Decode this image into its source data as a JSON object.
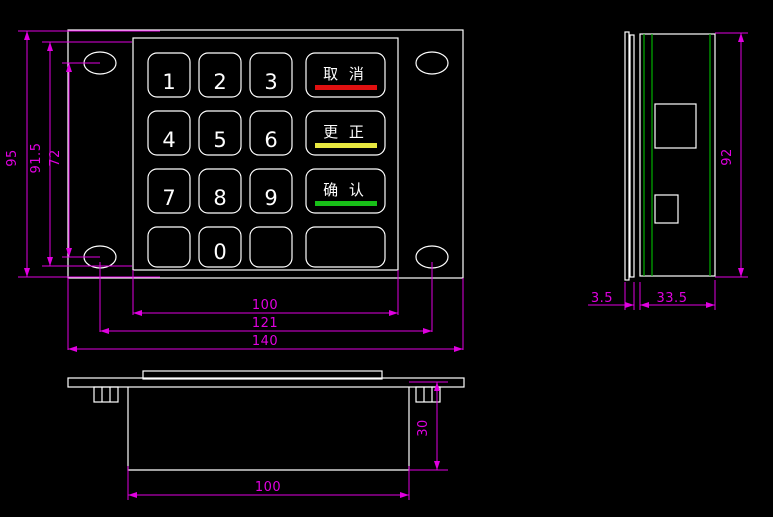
{
  "drawing": {
    "title": "Metal Keypad Technical Drawing",
    "background_color": "#000000",
    "line_color": "#ffffff",
    "dimension_color": "#e000e0",
    "accent_green": "#00b000"
  },
  "front_view": {
    "name": "front-view",
    "keys": [
      {
        "label": "1",
        "type": "digit"
      },
      {
        "label": "2",
        "type": "digit"
      },
      {
        "label": "3",
        "type": "digit"
      },
      {
        "label": "取 消",
        "type": "function",
        "underline_color": "#e01010"
      },
      {
        "label": "4",
        "type": "digit"
      },
      {
        "label": "5",
        "type": "digit"
      },
      {
        "label": "6",
        "type": "digit"
      },
      {
        "label": "更 正",
        "type": "function",
        "underline_color": "#e8e840"
      },
      {
        "label": "7",
        "type": "digit"
      },
      {
        "label": "8",
        "type": "digit"
      },
      {
        "label": "9",
        "type": "digit"
      },
      {
        "label": "确 认",
        "type": "function",
        "underline_color": "#18c018"
      },
      {
        "label": "",
        "type": "blank"
      },
      {
        "label": "0",
        "type": "digit"
      },
      {
        "label": "",
        "type": "blank"
      },
      {
        "label": "",
        "type": "blank-wide"
      }
    ],
    "mounting_holes": 4,
    "dimensions": {
      "height_outer": "95",
      "height_mid": "91.5",
      "height_hole_spacing": "72",
      "width_plate": "100",
      "width_mid": "121",
      "width_outer": "140"
    }
  },
  "side_view": {
    "name": "side-view",
    "dimensions": {
      "height": "92",
      "bezel_thickness": "3.5",
      "body_depth": "33.5"
    },
    "connectors": 2
  },
  "bottom_view": {
    "name": "bottom-view",
    "dimensions": {
      "width": "100",
      "depth": "30"
    },
    "tabs": 2
  }
}
